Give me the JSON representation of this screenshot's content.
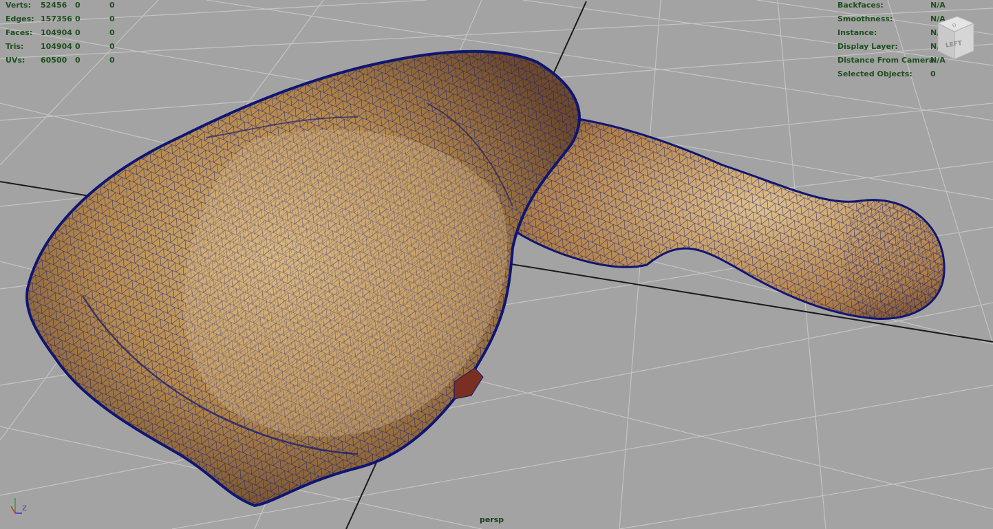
{
  "hud_stats": {
    "rows": [
      {
        "label": "Verts:",
        "v1": "52456",
        "v2": "0",
        "v3": "0"
      },
      {
        "label": "Edges:",
        "v1": "157356",
        "v2": "0",
        "v3": "0"
      },
      {
        "label": "Faces:",
        "v1": "104904",
        "v2": "0",
        "v3": "0"
      },
      {
        "label": "Tris:",
        "v1": "104904",
        "v2": "0",
        "v3": "0"
      },
      {
        "label": "UVs:",
        "v1": "60500",
        "v2": "0",
        "v3": "0"
      }
    ]
  },
  "hud_info": {
    "rows": [
      {
        "label": "Backfaces:",
        "value": "N/A"
      },
      {
        "label": "Smoothness:",
        "value": "N/A"
      },
      {
        "label": "Instance:",
        "value": "N/A"
      },
      {
        "label": "Display Layer:",
        "value": "N/A"
      },
      {
        "label": "Distance From Camera:",
        "value": "N/A"
      },
      {
        "label": "Selected Objects:",
        "value": "0"
      }
    ]
  },
  "camera_label": "persp",
  "view_cube_label": "LEFT",
  "axis_label": "Z",
  "colors": {
    "background": "#a3a3a3",
    "grid": "#c4c4c4",
    "hud_text": "#1f4f1f",
    "wireframe": "#141a78",
    "mesh_fill": "#c2995a"
  },
  "icons": {
    "view_cube": "view-cube-icon",
    "axis": "axis-gizmo-icon"
  }
}
